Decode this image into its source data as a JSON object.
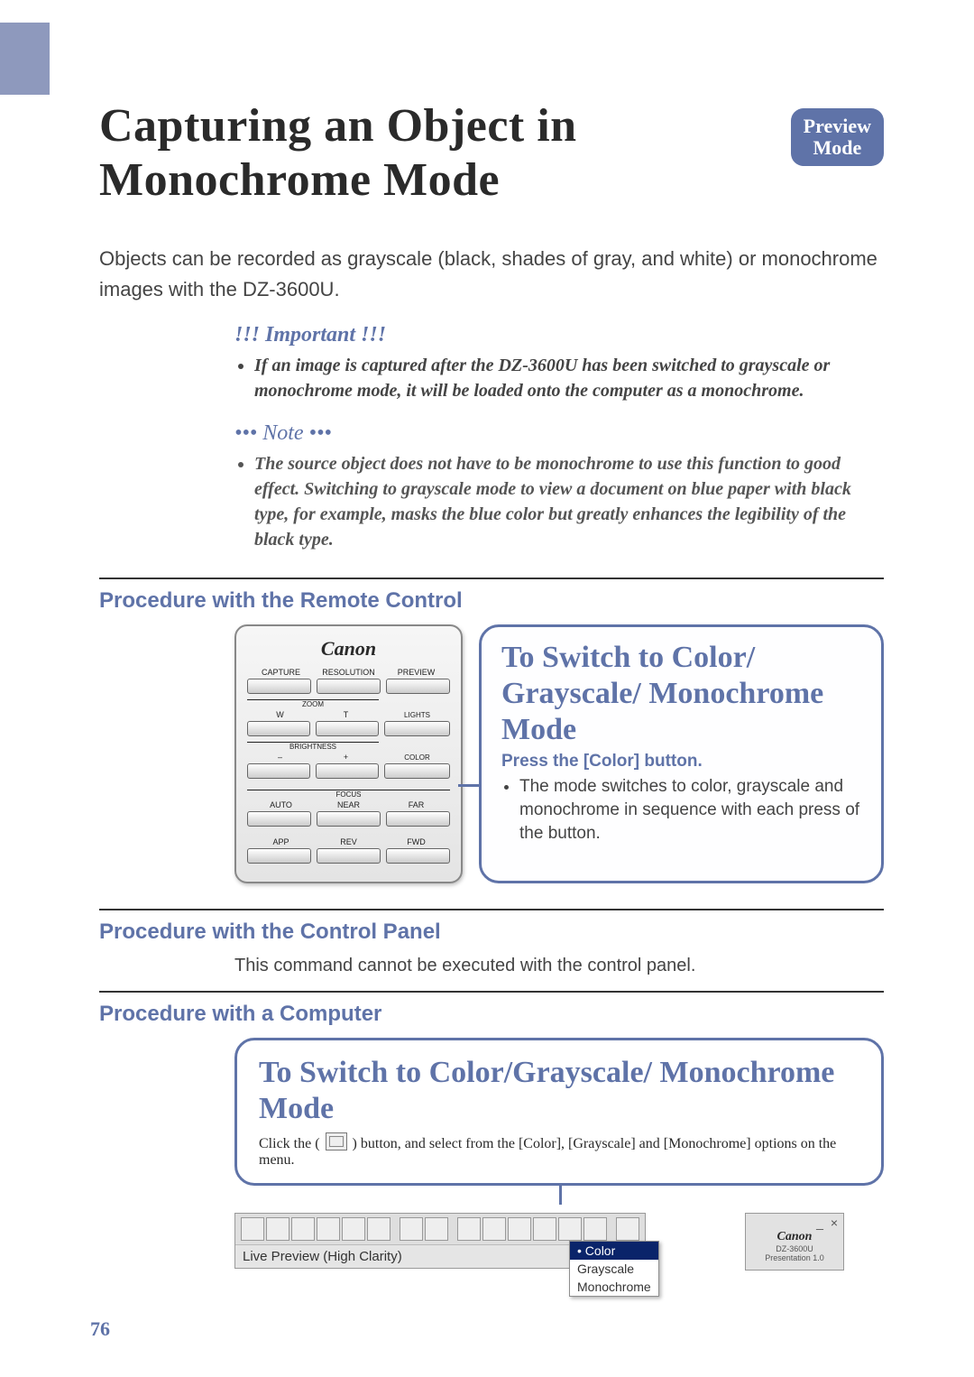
{
  "badge": {
    "line1": "Preview",
    "line2": "Mode"
  },
  "title": "Capturing an Object in Monochrome Mode",
  "intro": "Objects can be recorded as grayscale (black, shades of gray, and white) or monochrome images with the DZ-3600U.",
  "important": {
    "heading": "!!! Important !!!",
    "bullet": "If an image is captured after the DZ-3600U has been switched to grayscale or monochrome mode, it will be loaded onto the computer as a monochrome."
  },
  "note": {
    "heading": "••• Note •••",
    "bullet": "The source object does not have to be monochrome to use this function to good effect. Switching to grayscale mode to view a document on blue paper with black type, for example, masks the blue color but greatly enhances the legibility of the black type."
  },
  "proc_remote": {
    "heading": "Procedure with the Remote Control",
    "remote": {
      "brand": "Canon",
      "row1": [
        "CAPTURE",
        "RESOLUTION",
        "PREVIEW"
      ],
      "zoom_group": "ZOOM",
      "zoom": [
        "W",
        "T"
      ],
      "lights": "LIGHTS",
      "brightness_group": "BRIGHTNESS",
      "brightness": [
        "–",
        "+"
      ],
      "color": "COLOR",
      "focus_group": "FOCUS",
      "focus": [
        "AUTO",
        "NEAR",
        "FAR"
      ],
      "row4": [
        "APP",
        "REV",
        "FWD"
      ]
    },
    "callout": {
      "title": "To Switch to Color/ Grayscale/ Monochrome Mode",
      "sub": "Press the [Color] button.",
      "bullet": "The mode switches to color, grayscale and monochrome in sequence with each press of the button."
    }
  },
  "proc_panel": {
    "heading": "Procedure with the Control Panel",
    "text": "This command cannot be executed with the control panel."
  },
  "proc_computer": {
    "heading": "Procedure with a Computer",
    "callout": {
      "title": "To Switch to Color/Grayscale/ Monochrome Mode",
      "line1a": "Click the ( ",
      "line1b": " ) button, and select from the [Color], [Grayscale] and [Monochrome] options on the menu."
    },
    "toolbar": {
      "status": "Live Preview (High Clarity)",
      "dropdown": {
        "sel": "• Color",
        "opts": [
          "Grayscale",
          "Monochrome"
        ]
      }
    },
    "sidepanel": {
      "brand": "Canon",
      "model": "DZ-3600U",
      "app": "Presentation 1.0"
    }
  },
  "page_number": "76"
}
